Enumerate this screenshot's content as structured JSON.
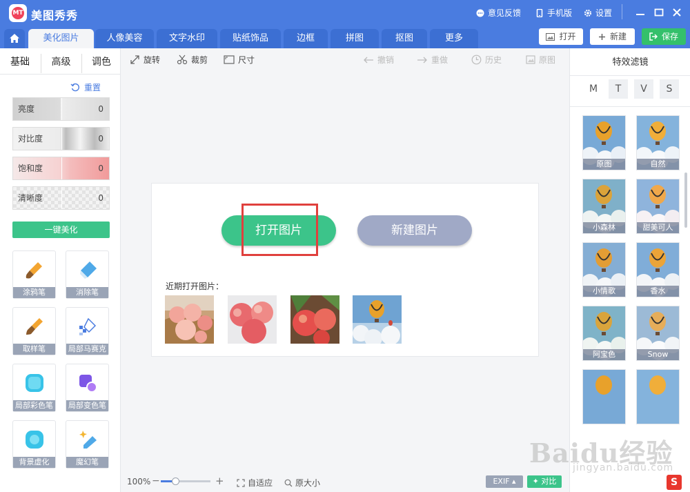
{
  "app": {
    "title": "美图秀秀",
    "logo_text": "MT"
  },
  "titlebar": {
    "feedback": "意见反馈",
    "mobile": "手机版",
    "settings": "设置"
  },
  "nav": {
    "tabs": [
      "美化图片",
      "人像美容",
      "文字水印",
      "贴纸饰品",
      "边框",
      "拼图",
      "抠图",
      "更多"
    ],
    "open_label": "打开",
    "new_label": "新建",
    "save_label": "保存"
  },
  "left": {
    "tabs": [
      "基础",
      "高级",
      "调色"
    ],
    "reset": "重置",
    "sliders": [
      {
        "label": "亮度",
        "value": "0"
      },
      {
        "label": "对比度",
        "value": "0"
      },
      {
        "label": "饱和度",
        "value": "0"
      },
      {
        "label": "清晰度",
        "value": "0"
      }
    ],
    "onekey": "一键美化",
    "tools": [
      "涂鸦笔",
      "消除笔",
      "取样笔",
      "局部马赛克",
      "局部彩色笔",
      "局部变色笔",
      "背景虚化",
      "魔幻笔"
    ]
  },
  "toolbar": {
    "rotate": "旋转",
    "crop": "裁剪",
    "size": "尺寸",
    "undo": "撤销",
    "redo": "重做",
    "history": "历史",
    "original": "原图"
  },
  "canvas": {
    "open_image": "打开图片",
    "new_image": "新建图片",
    "recent_label": "近期打开图片："
  },
  "right": {
    "title": "特效滤镜",
    "tabs": [
      "M",
      "T",
      "V",
      "S"
    ],
    "filters": [
      "原图",
      "自然",
      "小森林",
      "甜美可人",
      "小情歌",
      "香水",
      "阿宝色",
      "Snow"
    ]
  },
  "status": {
    "zoom": "100%",
    "fit": "自适应",
    "actual": "原大小",
    "exif": "EXIF",
    "compare": "对比"
  },
  "watermark": {
    "brand": "Baidu经验",
    "url": "jingyan.baidu.com",
    "badge": "S"
  },
  "colors": {
    "primary": "#4a7ce0",
    "green": "#3cc48a",
    "highlight": "#e0403d"
  }
}
